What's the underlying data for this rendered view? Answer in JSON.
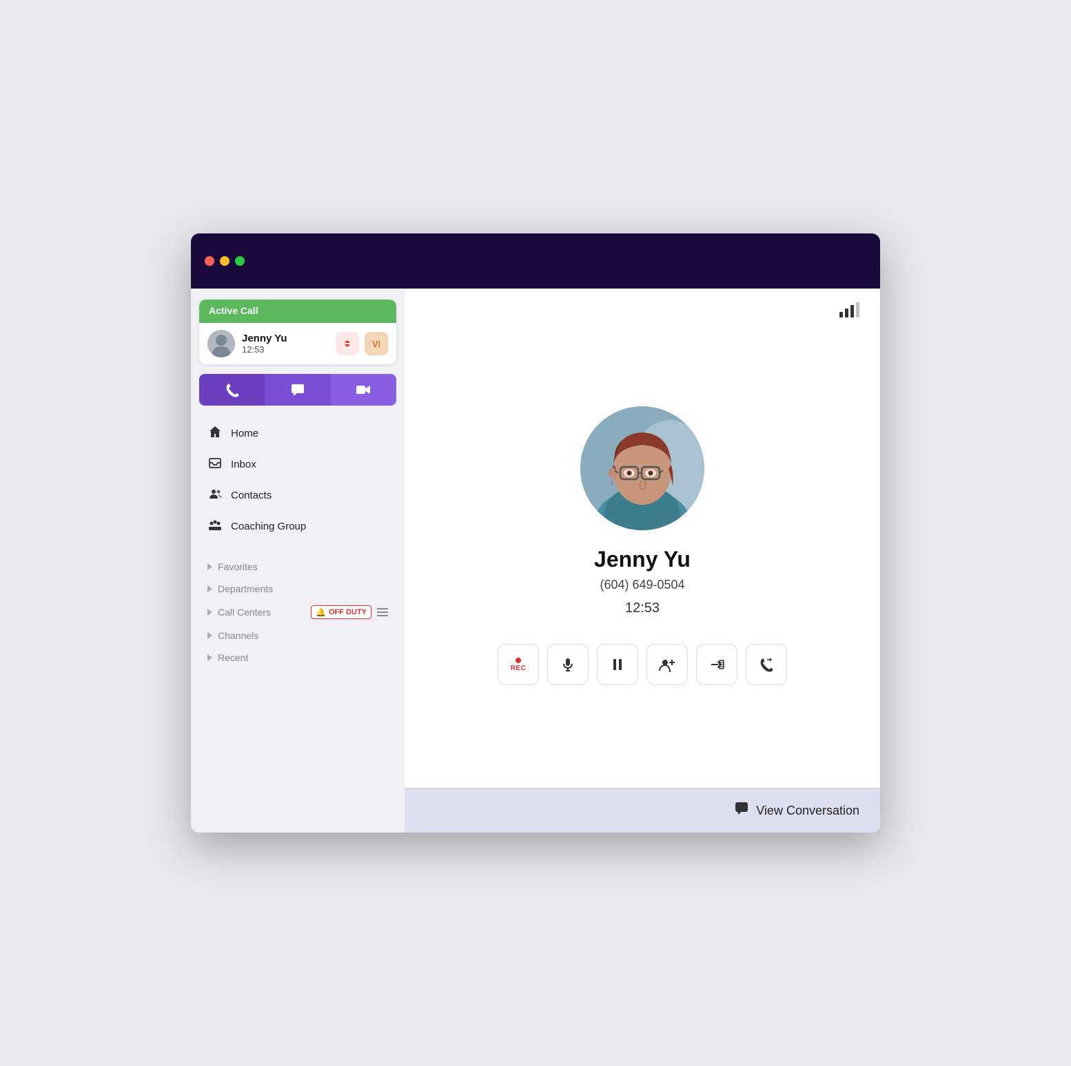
{
  "window": {
    "controls": {
      "close": "close",
      "minimize": "minimize",
      "maximize": "maximize"
    }
  },
  "sidebar": {
    "active_call": {
      "header": "Active Call",
      "caller_name": "Jenny Yu",
      "duration": "12:53",
      "transfer_label": "transfer",
      "vi_label": "Vi"
    },
    "action_tabs": [
      {
        "id": "phone",
        "label": "📞"
      },
      {
        "id": "chat",
        "label": "💬"
      },
      {
        "id": "video",
        "label": "📹"
      }
    ],
    "nav_items": [
      {
        "id": "home",
        "label": "Home",
        "icon": "🏠"
      },
      {
        "id": "inbox",
        "label": "Inbox",
        "icon": "🖥"
      },
      {
        "id": "contacts",
        "label": "Contacts",
        "icon": "👥"
      },
      {
        "id": "coaching",
        "label": "Coaching Group",
        "icon": "👥"
      }
    ],
    "collapsibles": [
      {
        "id": "favorites",
        "label": "Favorites",
        "has_badge": false,
        "badge_text": ""
      },
      {
        "id": "departments",
        "label": "Departments",
        "has_badge": false,
        "badge_text": ""
      },
      {
        "id": "call_centers",
        "label": "Call Centers",
        "has_badge": true,
        "badge_text": "OFF DUTY"
      },
      {
        "id": "channels",
        "label": "Channels",
        "has_badge": false,
        "badge_text": ""
      },
      {
        "id": "recent",
        "label": "Recent",
        "has_badge": false,
        "badge_text": ""
      }
    ]
  },
  "main": {
    "contact": {
      "name": "Jenny Yu",
      "phone": "(604) 649-0504",
      "duration": "12:53"
    },
    "controls": [
      {
        "id": "record",
        "label": "REC",
        "type": "rec"
      },
      {
        "id": "mute",
        "label": "🎤",
        "type": "icon"
      },
      {
        "id": "pause",
        "label": "⏸",
        "type": "icon"
      },
      {
        "id": "add_call",
        "label": "➕👤",
        "type": "icon"
      },
      {
        "id": "transfer",
        "label": "→☰",
        "type": "icon"
      },
      {
        "id": "flip",
        "label": "☎",
        "type": "icon"
      }
    ],
    "bottom_bar": {
      "view_conversation_label": "View Conversation"
    }
  }
}
